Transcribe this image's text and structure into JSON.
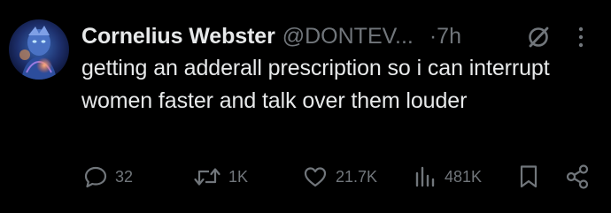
{
  "author": {
    "display_name": "Cornelius Webster",
    "handle": "@DONTEV...",
    "time": "·7h"
  },
  "tweet": {
    "text": "getting an adderall prescription so i can interrupt women faster and talk over them louder"
  },
  "actions": {
    "replies": "32",
    "reposts": "1K",
    "likes": "21.7K",
    "views": "481K"
  },
  "icons": {
    "grok": "grok-icon",
    "more": "more-options-icon",
    "reply": "reply-icon",
    "repost": "repost-icon",
    "like": "heart-icon",
    "views": "views-icon",
    "bookmark": "bookmark-icon",
    "share": "share-icon"
  },
  "colors": {
    "background": "#000000",
    "text": "#e7e9ea",
    "muted": "#71767b"
  }
}
